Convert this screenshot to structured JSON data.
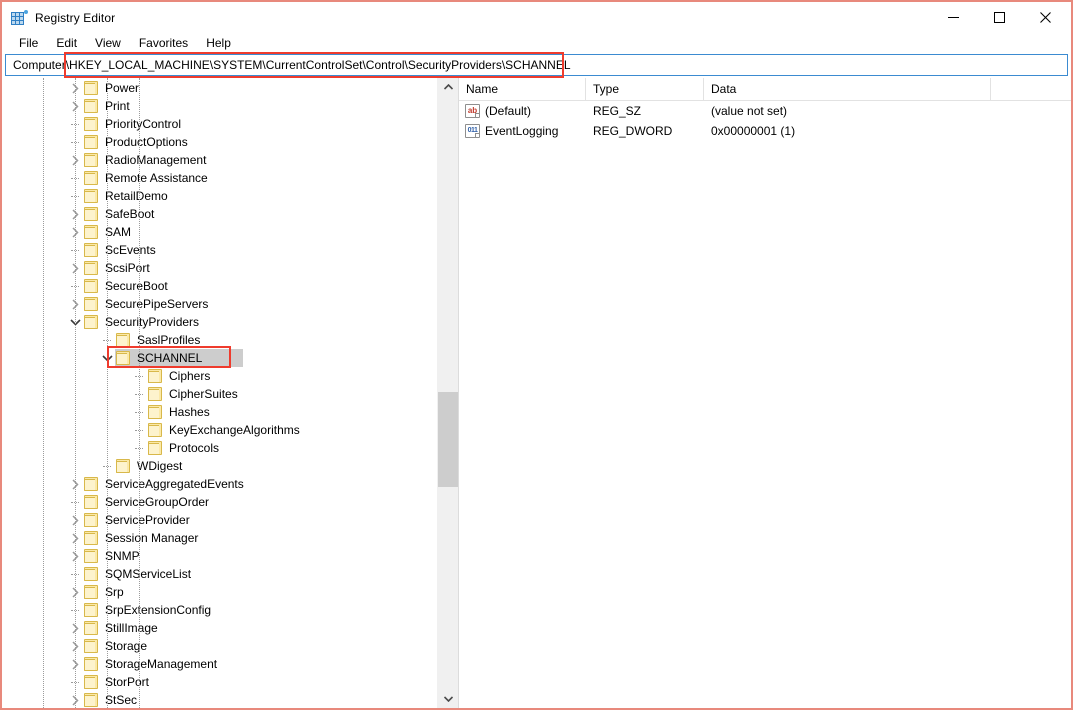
{
  "window": {
    "title": "Registry Editor",
    "icon": "registry-editor-icon",
    "frame_color": "#e8897c",
    "controls": {
      "minimize": "minimize-icon",
      "maximize": "maximize-icon",
      "close": "close-icon"
    }
  },
  "menubar": {
    "items": [
      "File",
      "Edit",
      "View",
      "Favorites",
      "Help"
    ]
  },
  "address": {
    "prefix": "Computer\\",
    "path": "HKEY_LOCAL_MACHINE\\SYSTEM\\CurrentControlSet\\Control\\SecurityProviders\\SCHANNEL",
    "full": "Computer\\HKEY_LOCAL_MACHINE\\SYSTEM\\CurrentControlSet\\Control\\SecurityProviders\\SCHANNEL",
    "highlight_color": "#ef3b2d",
    "focus_border_color": "#3b8bd1"
  },
  "tree": {
    "selected_key": "SCHANNEL",
    "highlight_color": "#ef3b2d",
    "selection_color": "#cdcdcd",
    "items": [
      {
        "label": "Power",
        "depth": 1,
        "expander": "collapsed"
      },
      {
        "label": "Print",
        "depth": 1,
        "expander": "collapsed"
      },
      {
        "label": "PriorityControl",
        "depth": 1,
        "expander": "none"
      },
      {
        "label": "ProductOptions",
        "depth": 1,
        "expander": "none"
      },
      {
        "label": "RadioManagement",
        "depth": 1,
        "expander": "collapsed"
      },
      {
        "label": "Remote Assistance",
        "depth": 1,
        "expander": "none"
      },
      {
        "label": "RetailDemo",
        "depth": 1,
        "expander": "none"
      },
      {
        "label": "SafeBoot",
        "depth": 1,
        "expander": "collapsed"
      },
      {
        "label": "SAM",
        "depth": 1,
        "expander": "collapsed"
      },
      {
        "label": "ScEvents",
        "depth": 1,
        "expander": "none"
      },
      {
        "label": "ScsiPort",
        "depth": 1,
        "expander": "collapsed"
      },
      {
        "label": "SecureBoot",
        "depth": 1,
        "expander": "none"
      },
      {
        "label": "SecurePipeServers",
        "depth": 1,
        "expander": "collapsed"
      },
      {
        "label": "SecurityProviders",
        "depth": 1,
        "expander": "expanded"
      },
      {
        "label": "SaslProfiles",
        "depth": 2,
        "expander": "none"
      },
      {
        "label": "SCHANNEL",
        "depth": 2,
        "expander": "expanded",
        "selected": true
      },
      {
        "label": "Ciphers",
        "depth": 3,
        "expander": "none"
      },
      {
        "label": "CipherSuites",
        "depth": 3,
        "expander": "none"
      },
      {
        "label": "Hashes",
        "depth": 3,
        "expander": "none"
      },
      {
        "label": "KeyExchangeAlgorithms",
        "depth": 3,
        "expander": "none"
      },
      {
        "label": "Protocols",
        "depth": 3,
        "expander": "none"
      },
      {
        "label": "WDigest",
        "depth": 2,
        "expander": "none"
      },
      {
        "label": "ServiceAggregatedEvents",
        "depth": 1,
        "expander": "collapsed"
      },
      {
        "label": "ServiceGroupOrder",
        "depth": 1,
        "expander": "none"
      },
      {
        "label": "ServiceProvider",
        "depth": 1,
        "expander": "collapsed"
      },
      {
        "label": "Session Manager",
        "depth": 1,
        "expander": "collapsed"
      },
      {
        "label": "SNMP",
        "depth": 1,
        "expander": "collapsed"
      },
      {
        "label": "SQMServiceList",
        "depth": 1,
        "expander": "none"
      },
      {
        "label": "Srp",
        "depth": 1,
        "expander": "collapsed"
      },
      {
        "label": "SrpExtensionConfig",
        "depth": 1,
        "expander": "none"
      },
      {
        "label": "StillImage",
        "depth": 1,
        "expander": "collapsed"
      },
      {
        "label": "Storage",
        "depth": 1,
        "expander": "collapsed"
      },
      {
        "label": "StorageManagement",
        "depth": 1,
        "expander": "collapsed"
      },
      {
        "label": "StorPort",
        "depth": 1,
        "expander": "none"
      },
      {
        "label": "StSec",
        "depth": 1,
        "expander": "collapsed"
      }
    ],
    "scrollbar": {
      "up_arrow": "chevron-up-icon",
      "down_arrow": "chevron-down-icon",
      "thumb_top_pct": 50,
      "thumb_height_pct": 16
    }
  },
  "values": {
    "columns": [
      "Name",
      "Type",
      "Data"
    ],
    "rows": [
      {
        "icon": "reg-sz-icon",
        "icon_text": "ab",
        "name": "(Default)",
        "type": "REG_SZ",
        "data": "(value not set)"
      },
      {
        "icon": "reg-dword-icon",
        "icon_text": "011",
        "name": "EventLogging",
        "type": "REG_DWORD",
        "data": "0x00000001 (1)"
      }
    ]
  }
}
